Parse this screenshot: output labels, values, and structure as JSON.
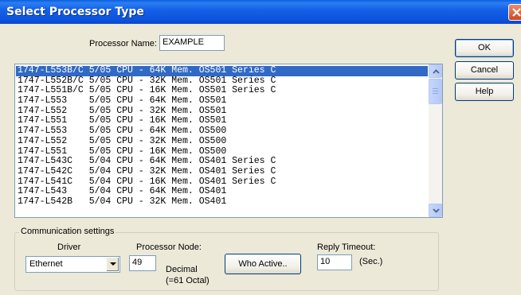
{
  "window": {
    "title": "Select Processor Type"
  },
  "processor_name": {
    "label": "Processor Name:",
    "value": "EXAMPLE"
  },
  "processor_list": {
    "selected_index": 0,
    "items": [
      "1747-L553B/C 5/05 CPU - 64K Mem. OS501 Series C",
      "1747-L552B/C 5/05 CPU - 32K Mem. OS501 Series C",
      "1747-L551B/C 5/05 CPU - 16K Mem. OS501 Series C",
      "1747-L553    5/05 CPU - 64K Mem. OS501",
      "1747-L552    5/05 CPU - 32K Mem. OS501",
      "1747-L551    5/05 CPU - 16K Mem. OS501",
      "1747-L553    5/05 CPU - 64K Mem. OS500",
      "1747-L552    5/05 CPU - 32K Mem. OS500",
      "1747-L551    5/05 CPU - 16K Mem. OS500",
      "1747-L543C   5/04 CPU - 64K Mem. OS401 Series C",
      "1747-L542C   5/04 CPU - 32K Mem. OS401 Series C",
      "1747-L541C   5/04 CPU - 16K Mem. OS401 Series C",
      "1747-L543    5/04 CPU - 64K Mem. OS401",
      "1747-L542B   5/04 CPU - 32K Mem. OS401"
    ]
  },
  "buttons": {
    "ok": "OK",
    "cancel": "Cancel",
    "help": "Help",
    "who_active": "Who Active.."
  },
  "comm": {
    "group_label": "Communication settings",
    "driver_label": "Driver",
    "driver_value": "Ethernet",
    "node_label": "Processor Node:",
    "node_value": "49",
    "decimal_label": "Decimal",
    "octal_label": "(=61 Octal)",
    "timeout_label": "Reply Timeout:",
    "timeout_value": "10",
    "timeout_unit": "(Sec.)"
  },
  "colors": {
    "title_bar": "#0a5ee0",
    "selection": "#316ac5",
    "dialog_bg": "#ece9d8"
  },
  "icons": {
    "close": "close-icon",
    "scroll_up": "chevron-up-icon",
    "scroll_down": "chevron-down-icon",
    "dropdown": "chevron-down-icon"
  }
}
